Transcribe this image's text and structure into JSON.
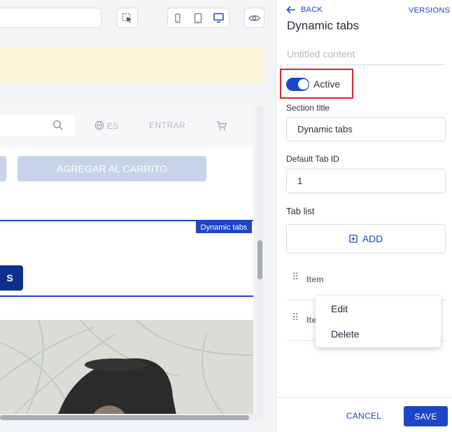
{
  "preview": {
    "nav_language": "ES",
    "nav_login": "ENTRAR",
    "add_to_cart": "AGREGAR AL CARRITO",
    "component_tag": "Dynamic tabs",
    "button_fragment": "S"
  },
  "panel": {
    "back_label": "BACK",
    "versions_label": "VERSIONS",
    "title": "Dynamic tabs",
    "content_name_placeholder": "Untitled content",
    "active_label": "Active",
    "active": true,
    "section_title_label": "Section title",
    "section_title_value": "Dynamic tabs",
    "default_tab_label": "Default Tab ID",
    "default_tab_value": "1",
    "tab_list_label": "Tab list",
    "add_label": "ADD",
    "items": [
      {
        "label": "Item"
      },
      {
        "label": "Ite"
      }
    ],
    "context_menu": {
      "edit": "Edit",
      "delete": "Delete"
    },
    "cancel_label": "CANCEL",
    "save_label": "SAVE"
  },
  "colors": {
    "accent": "#1d46c7",
    "highlight_border": "#d9262b",
    "notice_bg": "#fdf6d8"
  }
}
